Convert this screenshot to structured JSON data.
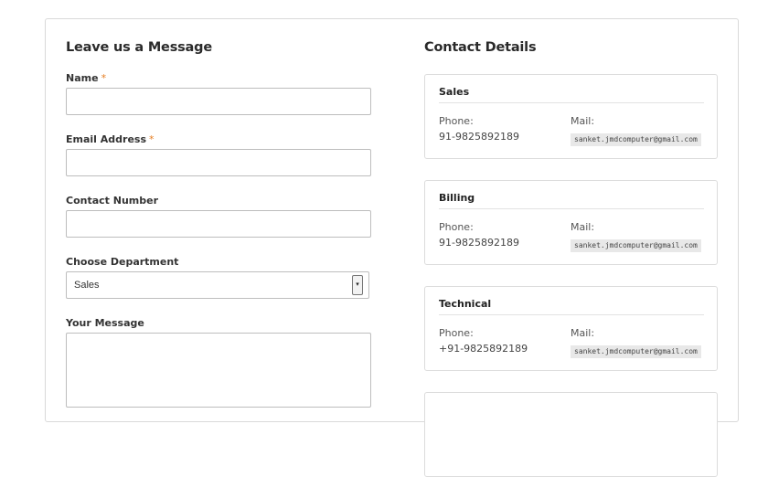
{
  "form": {
    "heading": "Leave us a Message",
    "name_label": "Name",
    "email_label": "Email Address",
    "required_marker": "*",
    "contact_label": "Contact Number",
    "department_label": "Choose Department",
    "department_selected": "Sales",
    "message_label": "Your Message"
  },
  "contact": {
    "heading": "Contact Details",
    "phone_label": "Phone:",
    "mail_label": "Mail:",
    "cards": [
      {
        "title": "Sales",
        "phone": "91-9825892189",
        "mail": "sanket.jmdcomputer@gmail.com"
      },
      {
        "title": "Billing",
        "phone": "91-9825892189",
        "mail": "sanket.jmdcomputer@gmail.com"
      },
      {
        "title": "Technical",
        "phone": "+91-9825892189",
        "mail": "sanket.jmdcomputer@gmail.com"
      }
    ]
  },
  "colors": {
    "required": "#e67e22",
    "border": "#bdbdbd",
    "mail_bg": "#e8e8e8"
  }
}
